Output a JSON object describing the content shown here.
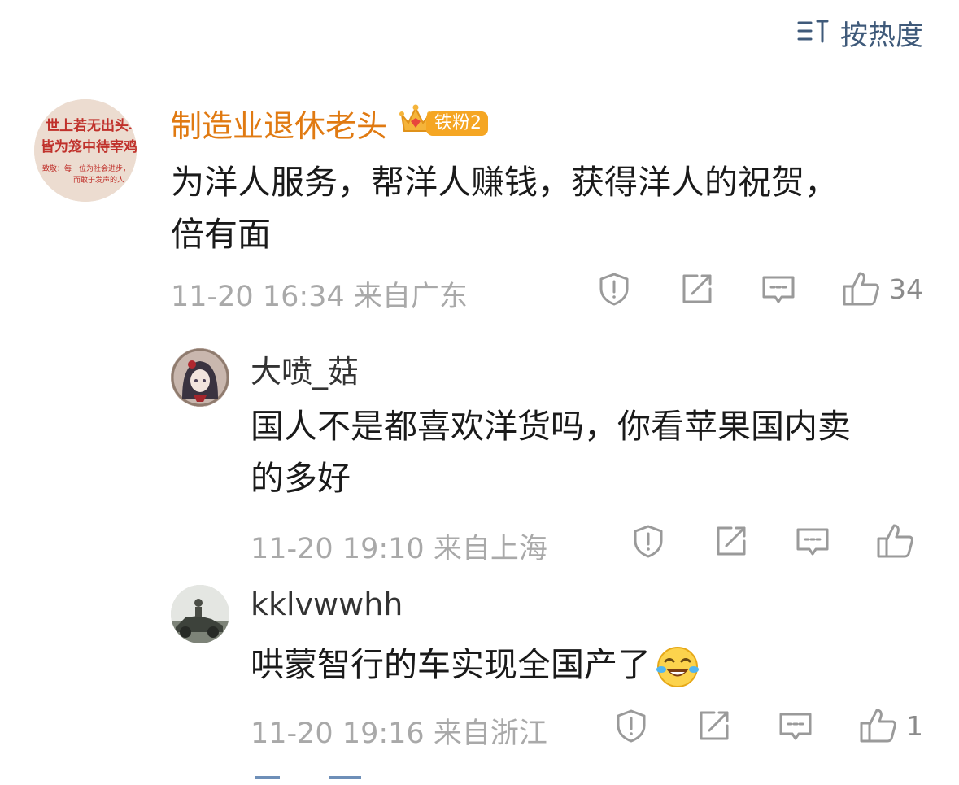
{
  "sort": {
    "icon": "sort-icon",
    "label": "按热度"
  },
  "comment": {
    "username": "制造业退休老头",
    "badge": {
      "icon": "crown-icon",
      "label": "铁粉2"
    },
    "avatar_text": [
      "世上若无出头鸟，",
      "皆为笼中待宰鸡。",
      "致敬：每一位为社会进步，",
      "而敢于发声的人"
    ],
    "text_lines": [
      "为洋人服务，帮洋人赚钱，获得洋人的祝贺，",
      "倍有面"
    ],
    "time": "11-20 16:34",
    "location": "来自广东",
    "like_count": "34"
  },
  "replies": [
    {
      "username": "大喷_菇",
      "text_lines": [
        "国人不是都喜欢洋货吗，你看苹果国内卖",
        "的多好"
      ],
      "time": "11-20 19:10",
      "location": "来自上海",
      "like_count": ""
    },
    {
      "username": "kklvwwhh",
      "text_lines": [
        "哄蒙智行的车实现全国产了"
      ],
      "emoji": "laughing-crying-emoji",
      "time": "11-20 19:16",
      "location": "来自浙江",
      "like_count": "1"
    }
  ],
  "colors": {
    "username_main": "#e07a12",
    "sort_text": "#3f5a7a",
    "meta_text": "#a9a9a9",
    "icon_gray": "#9a9a9a"
  }
}
